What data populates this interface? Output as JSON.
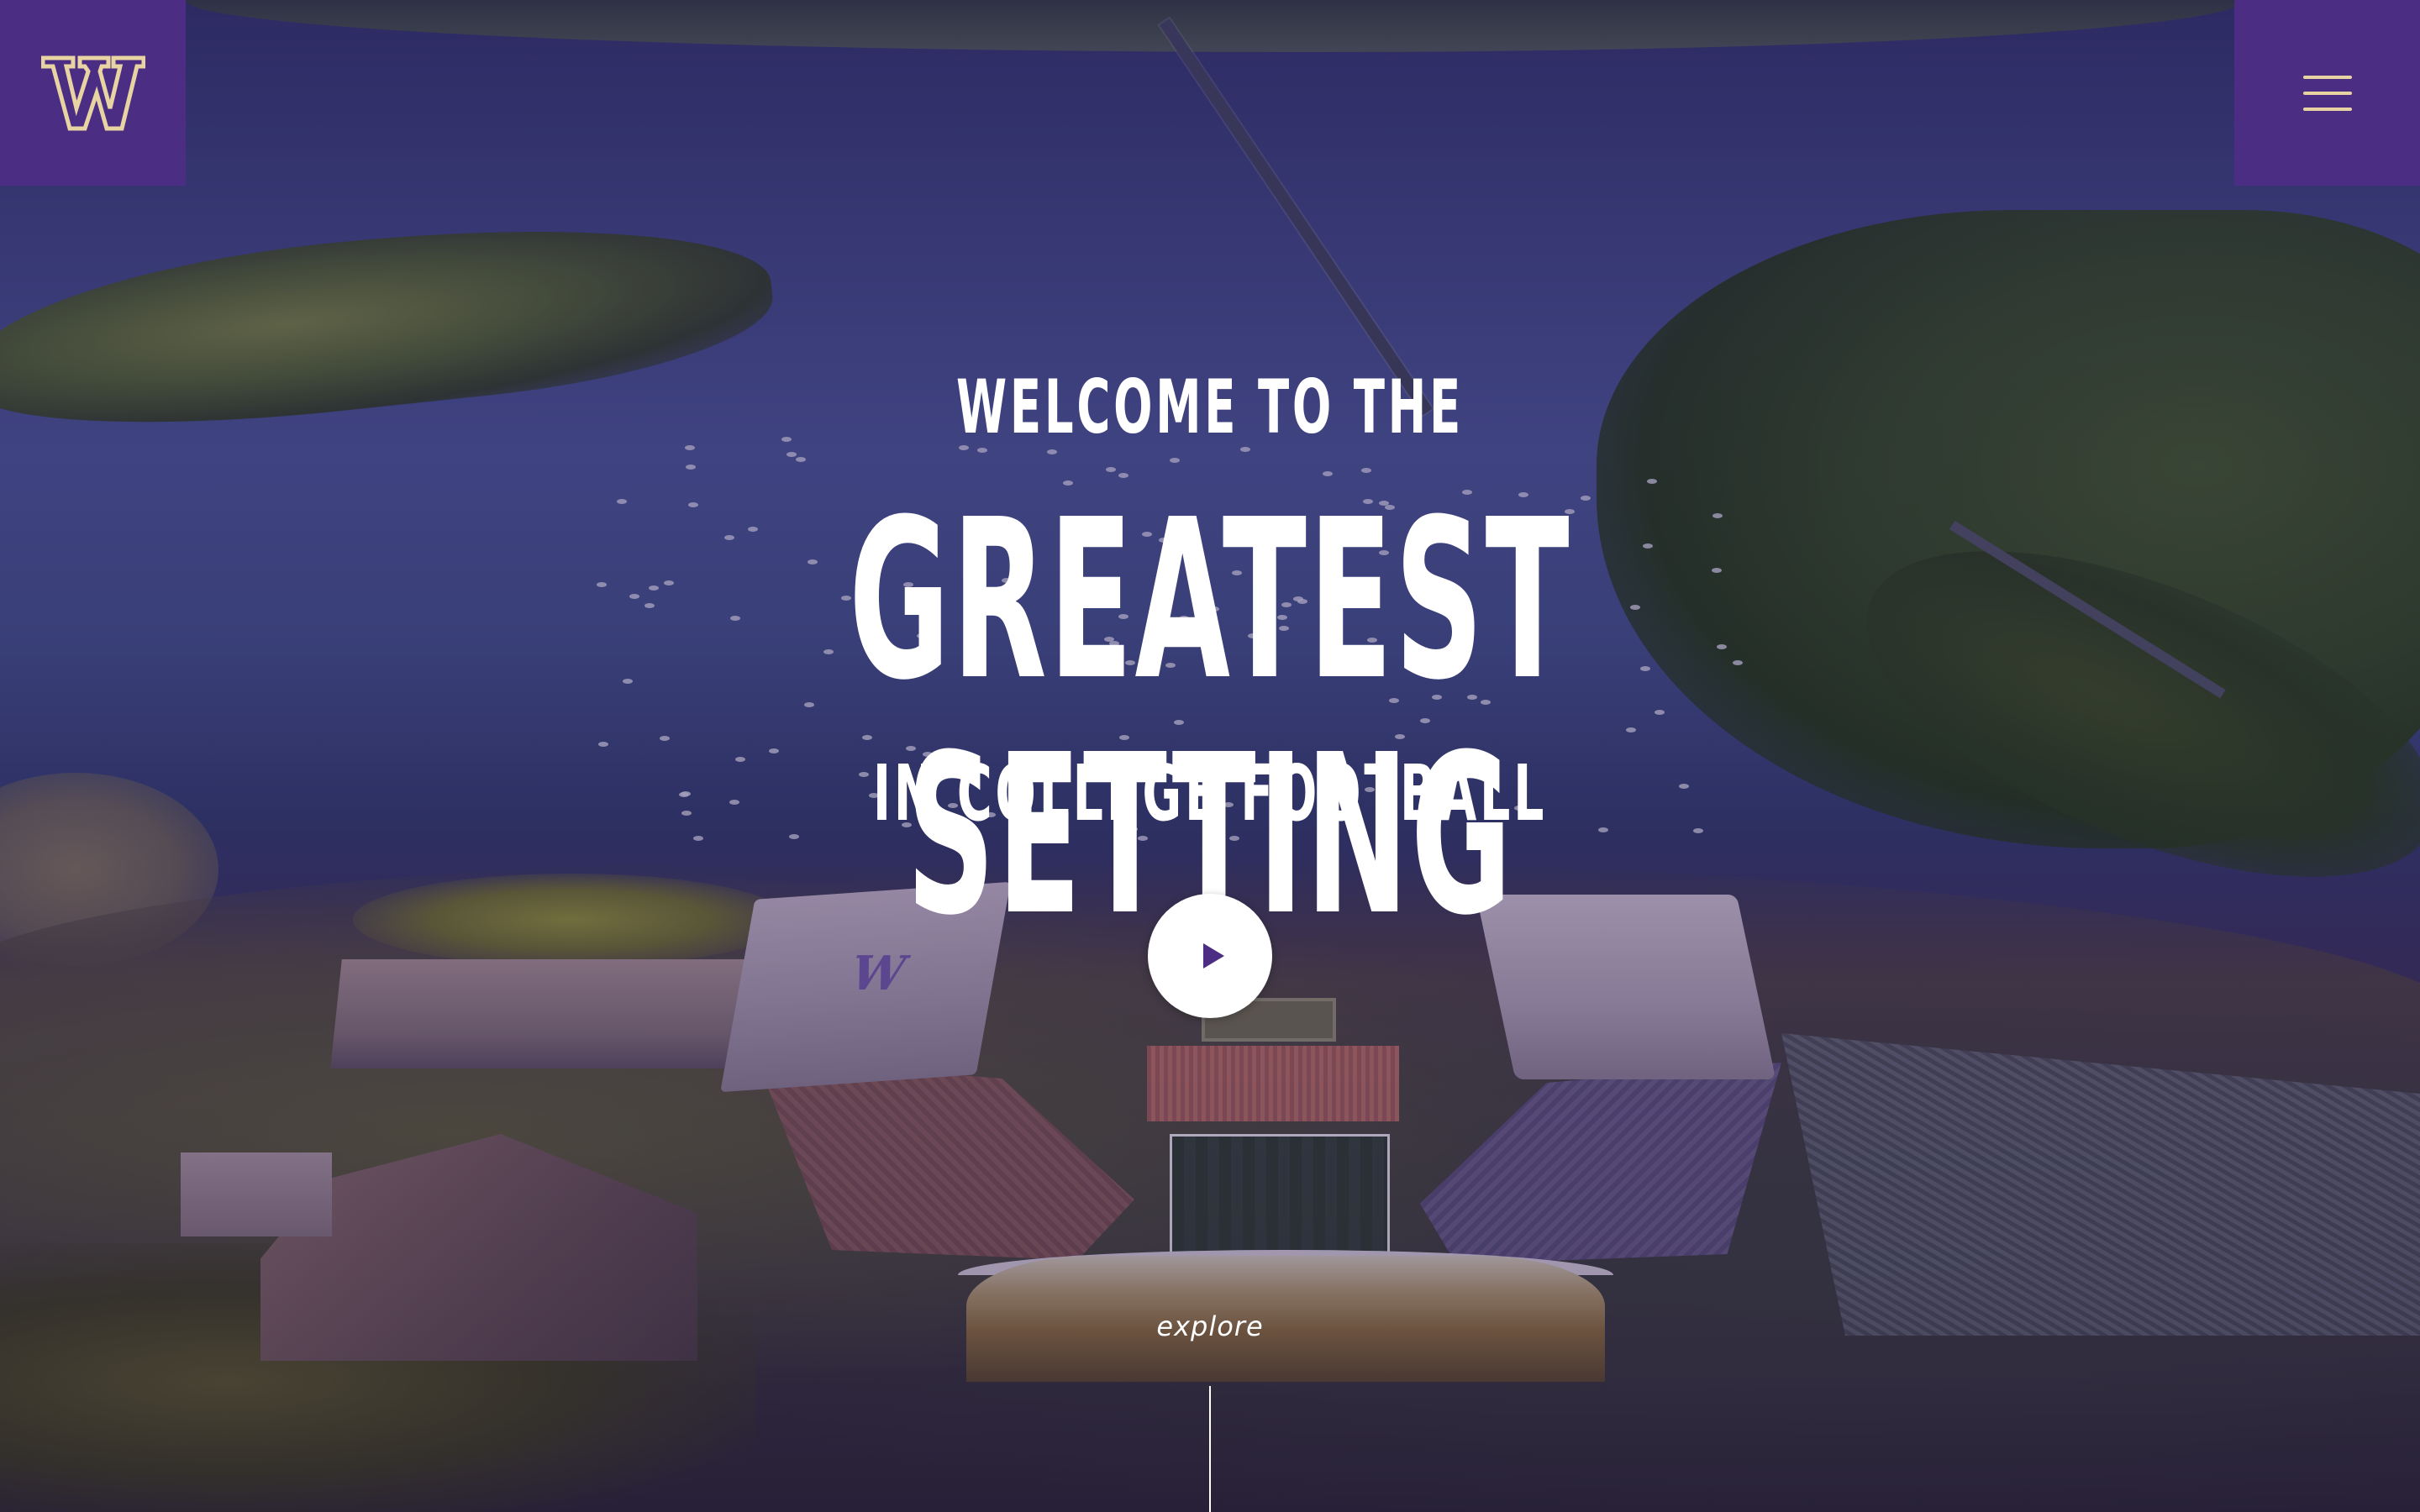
{
  "header": {
    "logo": {
      "icon": "w-logo-icon",
      "glyph": "W",
      "color": "#4b2e83",
      "accent": "#e8d3a2"
    },
    "menu": {
      "icon": "hamburger-menu-icon",
      "color": "#4b2e83",
      "accent": "#e8d3a2"
    }
  },
  "hero": {
    "line1": "WELCOME TO THE",
    "line2": "GREATEST SETTING",
    "line3": "IN COLLEGE FOOTBALL",
    "play_icon": "play-icon",
    "explore_label": "explore"
  },
  "colors": {
    "brand_purple": "#4b2e83",
    "brand_gold": "#e8d3a2",
    "text": "#ffffff"
  }
}
